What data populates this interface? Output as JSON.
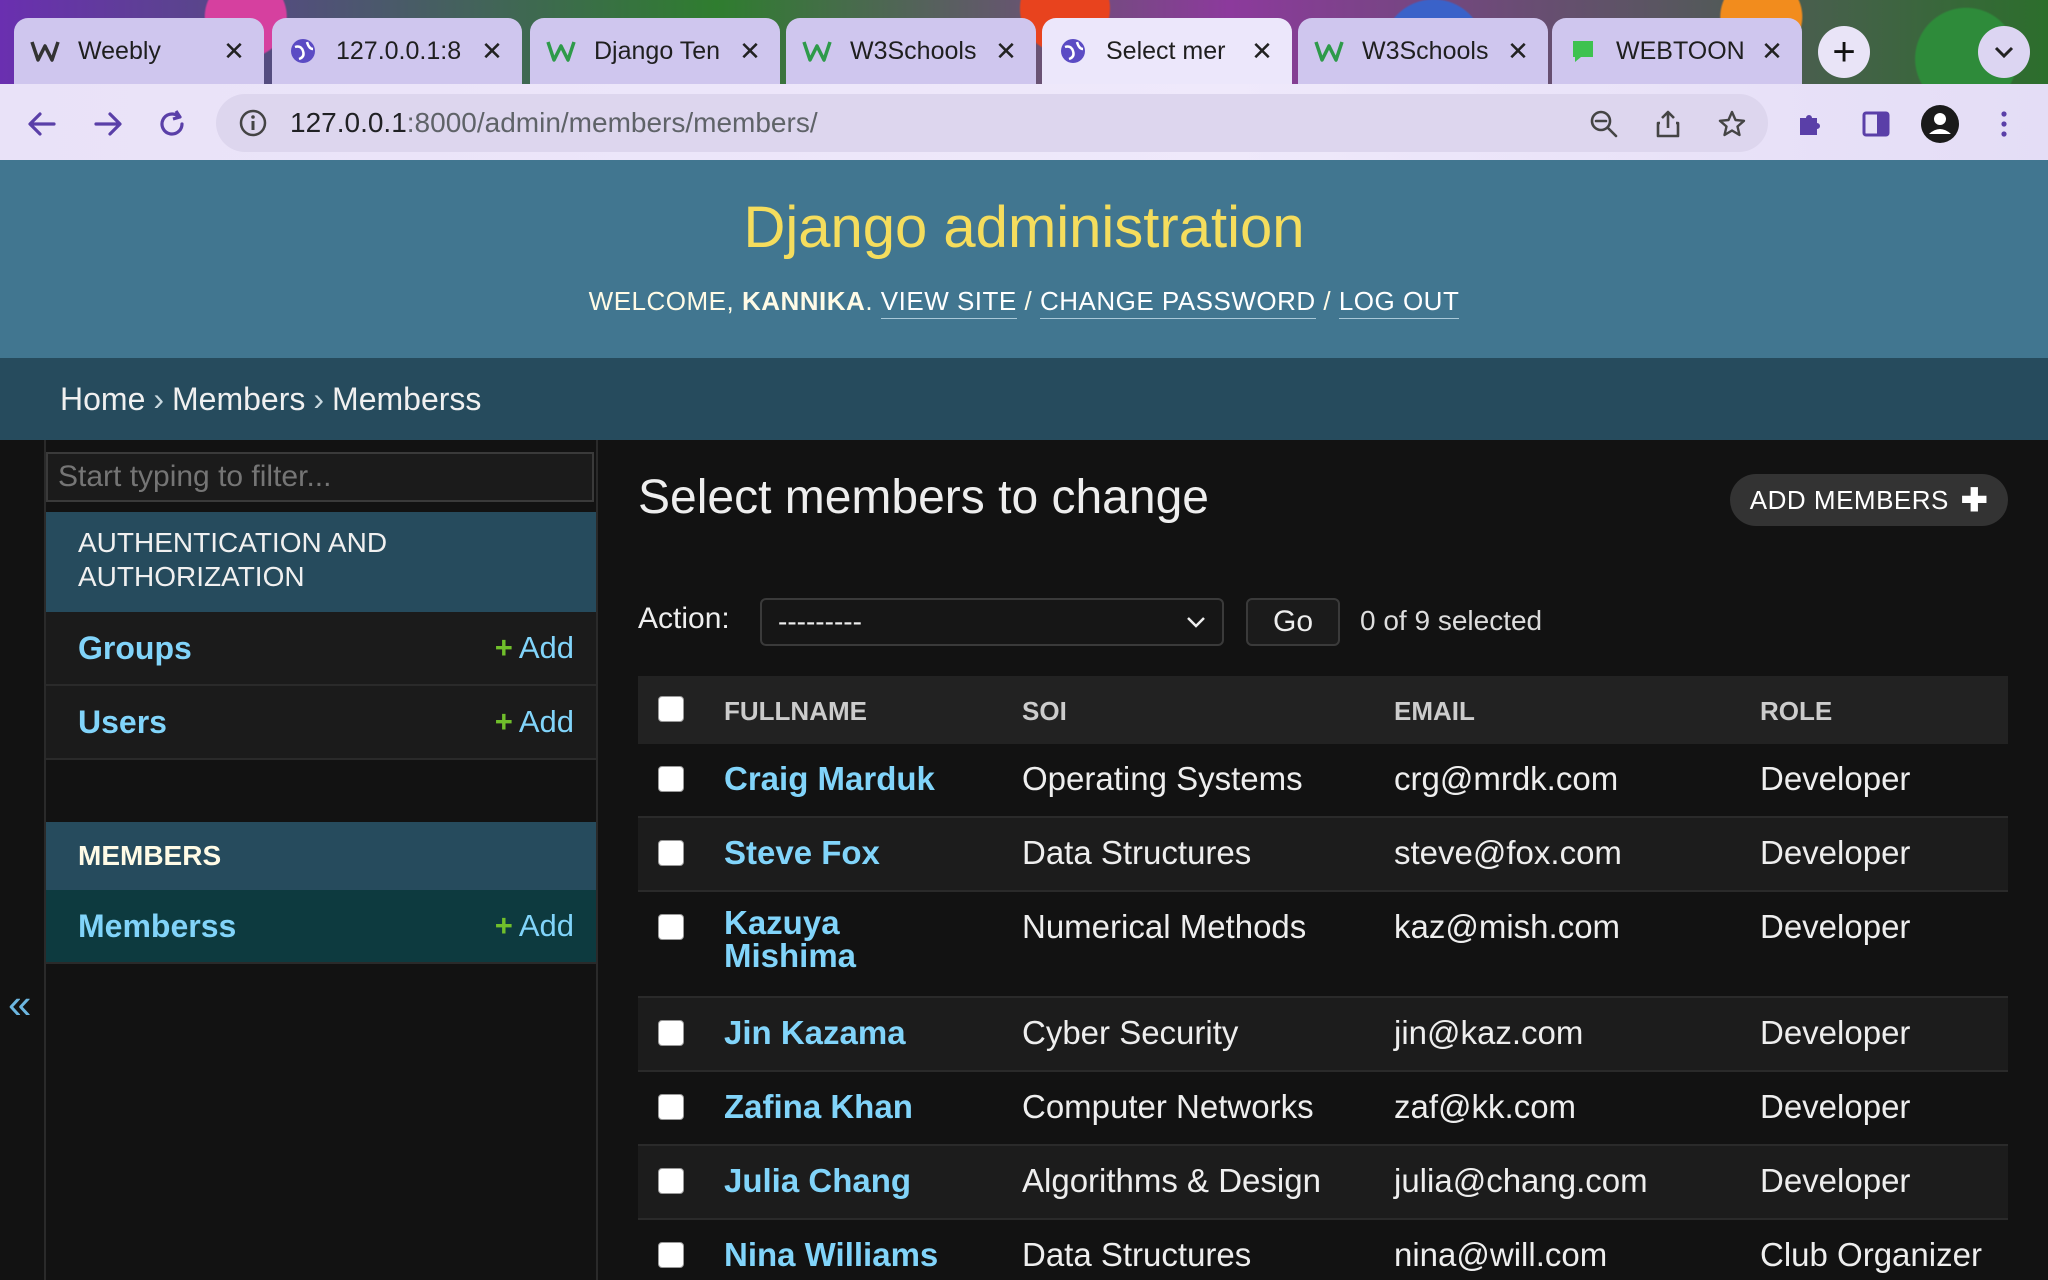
{
  "browser": {
    "tabs": [
      {
        "title": "Weebly",
        "icon": "weebly-icon",
        "active": false
      },
      {
        "title": "127.0.0.1:8",
        "icon": "globe-icon",
        "active": false
      },
      {
        "title": "Django Ten",
        "icon": "w3schools-icon",
        "active": false
      },
      {
        "title": "W3Schools",
        "icon": "w3schools-icon",
        "active": false
      },
      {
        "title": "Select mer",
        "icon": "globe-icon",
        "active": true
      },
      {
        "title": "W3Schools",
        "icon": "w3schools-icon",
        "active": false
      },
      {
        "title": "WEBTOON",
        "icon": "webtoon-icon",
        "active": false
      }
    ],
    "url_host": "127.0.0.1",
    "url_path": ":8000/admin/members/members/"
  },
  "header": {
    "title": "Django administration",
    "welcome": "WELCOME, ",
    "username": "KANNIKA",
    "dot": ". ",
    "view_site": "VIEW SITE",
    "sep": " / ",
    "change_password": "CHANGE PASSWORD",
    "log_out": "LOG OUT"
  },
  "breadcrumbs": {
    "home": "Home",
    "app": "Members",
    "model": "Memberss",
    "sep": "›"
  },
  "sidebar": {
    "filter_placeholder": "Start typing to filter...",
    "apps": [
      {
        "caption": "AUTHENTICATION AND AUTHORIZATION",
        "models": [
          {
            "name": "Groups",
            "add": "Add"
          },
          {
            "name": "Users",
            "add": "Add"
          }
        ]
      },
      {
        "caption": "MEMBERS",
        "models": [
          {
            "name": "Memberss",
            "add": "Add"
          }
        ]
      }
    ],
    "collapse": "«"
  },
  "content": {
    "title": "Select members to change",
    "add_button": "ADD MEMBERS",
    "action_label": "Action:",
    "action_value": "---------",
    "go": "Go",
    "counter": "0 of 9 selected",
    "columns": [
      "FULLNAME",
      "SOI",
      "EMAIL",
      "ROLE"
    ],
    "rows": [
      {
        "fullname": "Craig Marduk",
        "soi": "Operating Systems",
        "email": "crg@mrdk.com",
        "role": "Developer"
      },
      {
        "fullname": "Steve Fox",
        "soi": "Data Structures",
        "email": "steve@fox.com",
        "role": "Developer"
      },
      {
        "fullname": "Kazuya Mishima",
        "soi": "Numerical Methods",
        "email": "kaz@mish.com",
        "role": "Developer"
      },
      {
        "fullname": "Jin Kazama",
        "soi": "Cyber Security",
        "email": "jin@kaz.com",
        "role": "Developer"
      },
      {
        "fullname": "Zafina Khan",
        "soi": "Computer Networks",
        "email": "zaf@kk.com",
        "role": "Developer"
      },
      {
        "fullname": "Julia Chang",
        "soi": "Algorithms & Design",
        "email": "julia@chang.com",
        "role": "Developer"
      },
      {
        "fullname": "Nina Williams",
        "soi": "Data Structures",
        "email": "nina@will.com",
        "role": "Club Organizer"
      }
    ]
  },
  "colors": {
    "header_bg": "#417690",
    "title_yellow": "#f5dd5d",
    "breadcrumb_bg": "#264b5d",
    "link_blue": "#81d4fa",
    "add_green": "#70bf2b",
    "page_bg": "#121212"
  }
}
